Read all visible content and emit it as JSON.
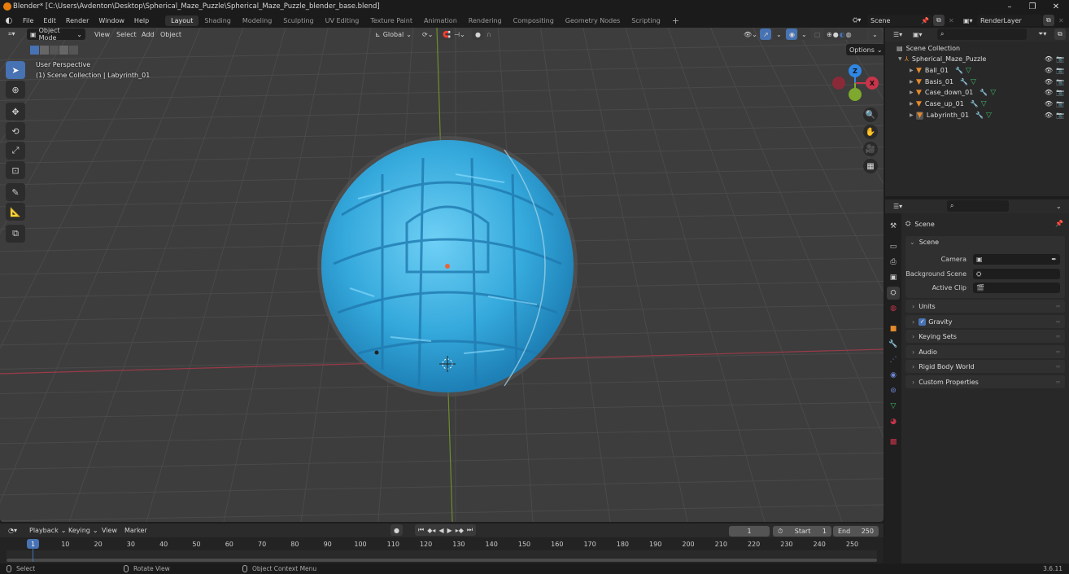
{
  "window": {
    "title": "Blender* [C:\\Users\\Avdenton\\Desktop\\Spherical_Maze_Puzzle\\Spherical_Maze_Puzzle_blender_base.blend]",
    "minimize_icon": "minimize-icon",
    "maximize_icon": "restore-icon",
    "close_icon": "close-icon"
  },
  "menu": {
    "items": [
      "File",
      "Edit",
      "Render",
      "Window",
      "Help"
    ]
  },
  "workspaces": {
    "tabs": [
      "Layout",
      "Shading",
      "Modeling",
      "Sculpting",
      "UV Editing",
      "Texture Paint",
      "Animation",
      "Rendering",
      "Compositing",
      "Geometry Nodes",
      "Scripting"
    ],
    "active": "Layout",
    "add_label": "+"
  },
  "scene_selector": {
    "scene": "Scene",
    "view_layer": "RenderLayer"
  },
  "viewport_header": {
    "mode": "Object Mode",
    "menus": [
      "View",
      "Select",
      "Add",
      "Object"
    ],
    "transform_orientation": "Global",
    "options_label": "Options"
  },
  "viewport_overlay": {
    "line1": "User Perspective",
    "line2": "(1) Scene Collection | Labyrinth_01"
  },
  "gizmo": {
    "z": "Z",
    "x": "X",
    "y": "Y"
  },
  "toolbar": {
    "tools": [
      "select-box",
      "cursor",
      "move",
      "rotate",
      "scale",
      "transform",
      "annotate",
      "measure",
      "add-cube"
    ],
    "active": "select-box"
  },
  "outliner": {
    "root": "Scene Collection",
    "collection": "Spherical_Maze_Puzzle",
    "objects": [
      {
        "name": "Ball_01"
      },
      {
        "name": "Basis_01"
      },
      {
        "name": "Case_down_01"
      },
      {
        "name": "Case_up_01"
      },
      {
        "name": "Labyrinth_01",
        "active": true
      }
    ]
  },
  "properties": {
    "context": "Scene",
    "section": "Scene",
    "fields": [
      {
        "label": "Camera",
        "value": ""
      },
      {
        "label": "Background Scene",
        "value": ""
      },
      {
        "label": "Active Clip",
        "value": ""
      }
    ],
    "panels": [
      {
        "label": "Units",
        "checkbox": false
      },
      {
        "label": "Gravity",
        "checkbox": true,
        "checked": true
      },
      {
        "label": "Keying Sets",
        "checkbox": false
      },
      {
        "label": "Audio",
        "checkbox": false
      },
      {
        "label": "Rigid Body World",
        "checkbox": false
      },
      {
        "label": "Custom Properties",
        "checkbox": false
      }
    ]
  },
  "timeline": {
    "menus": [
      "Playback",
      "Keying",
      "View",
      "Marker"
    ],
    "current_frame": "1",
    "start_label": "Start",
    "start": "1",
    "end_label": "End",
    "end": "250",
    "ticks": [
      "10",
      "20",
      "30",
      "40",
      "50",
      "60",
      "70",
      "80",
      "90",
      "100",
      "110",
      "120",
      "130",
      "140",
      "150",
      "160",
      "170",
      "180",
      "190",
      "200",
      "210",
      "220",
      "230",
      "240",
      "250"
    ],
    "playhead": "1"
  },
  "statusbar": {
    "select": "Select",
    "rotate": "Rotate View",
    "context_menu": "Object Context Menu",
    "version": "3.6.11"
  },
  "colors": {
    "accent": "#4772b3",
    "x_axis": "#c8344a",
    "y_axis": "#7fa82e",
    "z_axis": "#2f87e6",
    "object_color": "#3aaede"
  }
}
